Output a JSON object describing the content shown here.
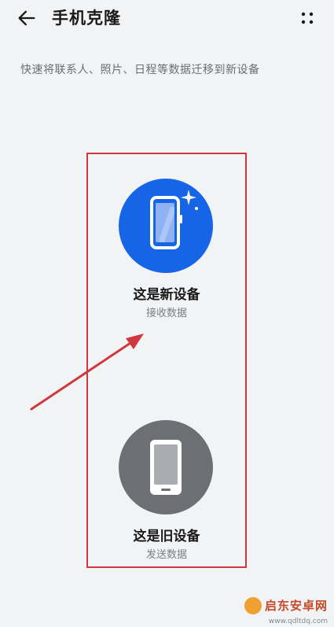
{
  "header": {
    "title": "手机克隆",
    "back_icon": "arrow-left-icon",
    "more_icon": "four-dots-icon"
  },
  "subtitle": "快速将联系人、照片、日程等数据迁移到新设备",
  "cards": [
    {
      "id": "new",
      "title": "这是新设备",
      "subtitle": "接收数据",
      "icon": "new-phone-sparkle-icon",
      "color": "#1565e6"
    },
    {
      "id": "old",
      "title": "这是旧设备",
      "subtitle": "发送数据",
      "icon": "old-phone-icon",
      "color": "#6c6f74"
    }
  ],
  "annotation_color": "#d0383f",
  "watermark": {
    "text": "启东安卓网",
    "url": "www.qdltdq.com"
  }
}
